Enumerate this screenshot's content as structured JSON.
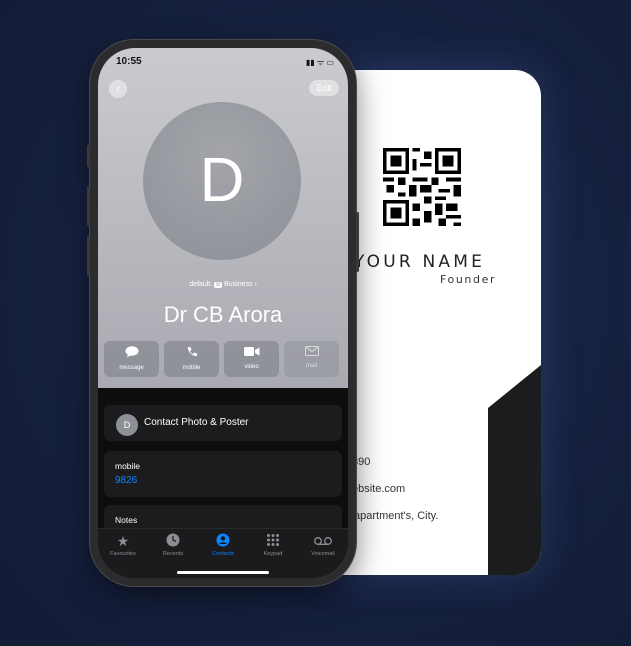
{
  "business_card": {
    "name": "YOUR NAME",
    "role": "Founder",
    "phone_fragment": "890",
    "website_fragment": "ebsite.com",
    "address_fragment": "apartment's, City."
  },
  "phone": {
    "status_bar": {
      "time": "10:55",
      "icons": "▮▮ ᯤ ▭"
    },
    "nav": {
      "back_icon": "‹",
      "edit_label": "Edit"
    },
    "contact": {
      "avatar_letter": "D",
      "default_label": "default:",
      "default_badge": "B",
      "default_value": "Business",
      "default_chevron": "›",
      "name": "Dr CB Arora"
    },
    "actions": [
      {
        "label": "message",
        "icon": "message-icon",
        "enabled": true
      },
      {
        "label": "mobile",
        "icon": "phone-icon",
        "enabled": true
      },
      {
        "label": "video",
        "icon": "video-icon",
        "enabled": true
      },
      {
        "label": "mail",
        "icon": "mail-icon",
        "enabled": false
      }
    ],
    "photo_poster": {
      "avatar_letter": "D",
      "label": "Contact Photo & Poster"
    },
    "mobile": {
      "label": "mobile",
      "value": "9826"
    },
    "notes": {
      "label": "Notes"
    },
    "tabs": [
      {
        "label": "Favourites",
        "icon": "star-icon",
        "active": false
      },
      {
        "label": "Recents",
        "icon": "clock-icon",
        "active": false
      },
      {
        "label": "Contacts",
        "icon": "person-icon",
        "active": true
      },
      {
        "label": "Keypad",
        "icon": "keypad-icon",
        "active": false
      },
      {
        "label": "Voicemail",
        "icon": "voicemail-icon",
        "active": false
      }
    ],
    "accent_color": "#0a84ff"
  }
}
